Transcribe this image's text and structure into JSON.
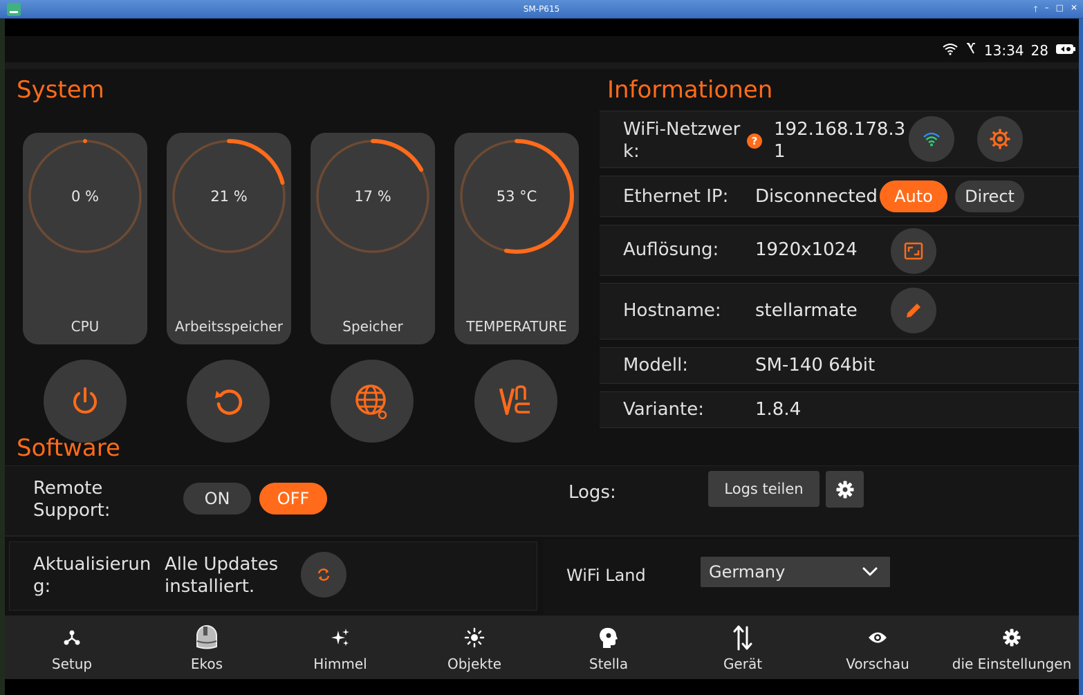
{
  "window": {
    "title": "SM-P615",
    "controls": [
      "🡑",
      "–",
      "□",
      "✕"
    ]
  },
  "status": {
    "time": "13:34",
    "battery": "28"
  },
  "colors": {
    "accent": "#ff6b1a",
    "card": "#3a3a3a",
    "ring_track": "#6b4a34"
  },
  "system": {
    "title": "System",
    "gauges": [
      {
        "value": "0 %",
        "label": "CPU",
        "percent": 0
      },
      {
        "value": "21 %",
        "label": "Arbeitsspeicher",
        "percent": 21
      },
      {
        "value": "17 %",
        "label": "Speicher",
        "percent": 17
      },
      {
        "value": "53 °C",
        "label": "TEMPERATURE",
        "percent": 53
      }
    ],
    "actions": [
      "power-icon",
      "restart-icon",
      "web-manager-icon",
      "vnc-icon"
    ]
  },
  "info": {
    "title": "Informationen",
    "wifi": {
      "label_line1": "WiFi-Netzwer",
      "label_line2": "k:",
      "help": "?",
      "value_line1": "192.168.178.3",
      "value_line2": "1"
    },
    "ethernet": {
      "label": "Ethernet IP:",
      "value": "Disconnected",
      "auto": "Auto",
      "direct": "Direct"
    },
    "resolution": {
      "label": "Auflösung:",
      "value": "1920x1024"
    },
    "hostname": {
      "label": "Hostname:",
      "value": "stellarmate"
    },
    "model": {
      "label": "Modell:",
      "value": "SM-140 64bit"
    },
    "variant": {
      "label": "Variante:",
      "value": "1.8.4"
    }
  },
  "software": {
    "title": "Software",
    "remote_label_line1": "Remote",
    "remote_label_line2": "Support:",
    "on": "ON",
    "off": "OFF",
    "logs_label": "Logs:",
    "logs_button": "Logs teilen",
    "update_label_line1": "Aktualisierun",
    "update_label_line2": "g:",
    "update_status_line1": "Alle Updates",
    "update_status_line2": "installiert.",
    "wifi_country_label": "WiFi Land",
    "wifi_country_value": "Germany"
  },
  "nav": [
    {
      "label": "Setup",
      "icon": "setup-icon"
    },
    {
      "label": "Ekos",
      "icon": "ekos-icon"
    },
    {
      "label": "Himmel",
      "icon": "sky-icon"
    },
    {
      "label": "Objekte",
      "icon": "objects-icon"
    },
    {
      "label": "Stella",
      "icon": "stella-icon"
    },
    {
      "label": "Gerät",
      "icon": "device-icon"
    },
    {
      "label": "Vorschau",
      "icon": "preview-icon"
    },
    {
      "label": "die Einstellungen",
      "icon": "settings-icon"
    }
  ]
}
